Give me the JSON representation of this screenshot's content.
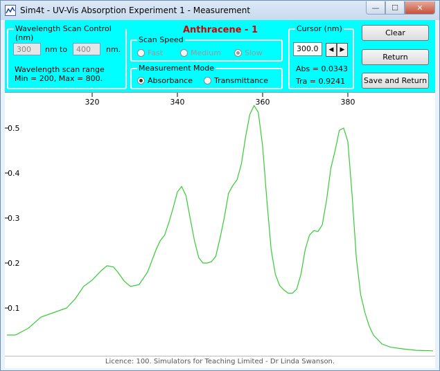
{
  "window": {
    "title": "Sim4t - UV-Vis Absorption Experiment 1 - Measurement",
    "min_glyph": "—",
    "max_glyph": "☐",
    "close_glyph": "✕"
  },
  "scan_control": {
    "group_label": "Wavelength Scan Control (nm)",
    "from_value": "300",
    "to_label": "to",
    "to_value": "400",
    "nm_label": "nm",
    "nm_end_label": "nm.",
    "range_line1": "Wavelength scan range",
    "range_line2": "Min = 200,  Max = 800."
  },
  "sample_name": "Anthracene - 1",
  "scan_speed": {
    "group_label": "Scan Speed",
    "options": [
      {
        "label": "Fast",
        "selected": false
      },
      {
        "label": "Medium",
        "selected": false
      },
      {
        "label": "Slow",
        "selected": true
      }
    ]
  },
  "measurement_mode": {
    "group_label": "Measurement Mode",
    "options": [
      {
        "label": "Absorbance",
        "selected": true
      },
      {
        "label": "Transmittance",
        "selected": false
      }
    ]
  },
  "cursor": {
    "group_label": "Cursor (nm)",
    "value": "300.0",
    "left_arrow": "◀",
    "right_arrow": "▶",
    "abs_text": "Abs = 0.0343",
    "tra_text": "Tra = 0.9241"
  },
  "buttons": {
    "clear": "Clear",
    "return": "Return",
    "save_return": "Save and Return"
  },
  "status_text": "Licence: 100. Simulators for Teaching Limited - Dr Linda Swanson.",
  "colors": {
    "panel": "#00ffff",
    "trace": "#33cc33",
    "heading": "#d40000"
  },
  "chart_data": {
    "type": "line",
    "xlim": [
      300,
      400
    ],
    "ylim": [
      0,
      0.6
    ],
    "xticks": [
      320,
      340,
      360,
      380
    ],
    "yticks": [
      0.1,
      0.2,
      0.3,
      0.4,
      0.5
    ],
    "xtick_labels": [
      "320",
      "340",
      "360",
      "380"
    ],
    "ytick_labels": [
      "0.1",
      "0.2",
      "0.3",
      "0.4",
      "0.5"
    ],
    "grid": false,
    "series": [
      {
        "x": [
          300,
          302,
          305,
          308,
          311,
          314,
          316,
          318,
          320,
          322,
          323.5,
          325,
          326,
          327.5,
          329,
          331,
          333,
          335,
          336,
          337,
          338,
          339,
          340,
          341,
          342,
          343,
          344,
          345,
          346,
          347,
          348,
          349,
          350,
          351,
          352,
          353,
          354,
          355,
          356,
          357,
          358,
          359,
          360,
          361,
          362,
          363,
          364,
          365,
          366,
          367,
          368,
          369,
          370,
          371,
          372,
          373,
          374,
          375,
          376,
          377,
          378,
          379,
          380,
          381,
          382,
          383,
          384,
          385,
          386,
          388,
          390,
          393,
          396,
          400
        ],
        "y": [
          0.04,
          0.04,
          0.055,
          0.08,
          0.09,
          0.1,
          0.12,
          0.148,
          0.162,
          0.182,
          0.194,
          0.191,
          0.18,
          0.16,
          0.148,
          0.152,
          0.18,
          0.23,
          0.25,
          0.262,
          0.29,
          0.322,
          0.358,
          0.37,
          0.35,
          0.3,
          0.25,
          0.212,
          0.2,
          0.2,
          0.203,
          0.215,
          0.255,
          0.3,
          0.355,
          0.372,
          0.385,
          0.42,
          0.48,
          0.53,
          0.55,
          0.535,
          0.46,
          0.34,
          0.23,
          0.175,
          0.15,
          0.14,
          0.133,
          0.133,
          0.142,
          0.175,
          0.23,
          0.262,
          0.272,
          0.27,
          0.285,
          0.34,
          0.41,
          0.45,
          0.495,
          0.5,
          0.47,
          0.35,
          0.21,
          0.13,
          0.09,
          0.06,
          0.04,
          0.02,
          0.013,
          0.009,
          0.006,
          0.005
        ]
      }
    ]
  }
}
